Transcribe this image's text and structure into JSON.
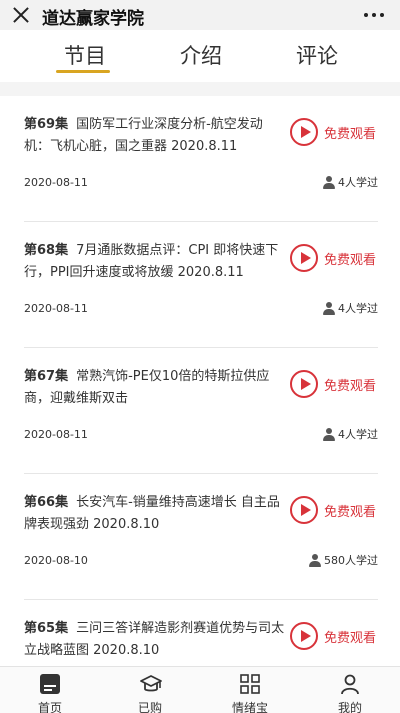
{
  "header": {
    "title": "道达赢家学院"
  },
  "tabs": [
    {
      "label": "节目",
      "active": true
    },
    {
      "label": "介绍",
      "active": false
    },
    {
      "label": "评论",
      "active": false
    }
  ],
  "play_label": "免费观看",
  "episodes": [
    {
      "ep": "第69集",
      "title": "国防军工行业深度分析-航空发动机：飞机心脏，国之重器 2020.8.11",
      "date": "2020-08-11",
      "learners": "4人学过"
    },
    {
      "ep": "第68集",
      "title": "7月通胀数据点评：CPI 即将快速下行，PPI回升速度或将放缓 2020.8.11",
      "date": "2020-08-11",
      "learners": "4人学过"
    },
    {
      "ep": "第67集",
      "title": "常熟汽饰-PE仅10倍的特斯拉供应商，迎戴维斯双击",
      "date": "2020-08-11",
      "learners": "4人学过"
    },
    {
      "ep": "第66集",
      "title": "长安汽车-销量维持高速增长 自主品牌表现强劲 2020.8.10",
      "date": "2020-08-10",
      "learners": "580人学过"
    },
    {
      "ep": "第65集",
      "title": "三问三答详解造影剂赛道优势与司太立战略蓝图 2020.8.10",
      "date": "",
      "learners": ""
    }
  ],
  "bottom_nav": [
    {
      "label": "首页",
      "icon": "home-icon"
    },
    {
      "label": "已购",
      "icon": "graduation-cap-icon"
    },
    {
      "label": "情绪宝",
      "icon": "grid-icon"
    },
    {
      "label": "我的",
      "icon": "user-icon"
    }
  ],
  "colors": {
    "accent": "#d8333a",
    "tab_underline": "#d9a521"
  }
}
